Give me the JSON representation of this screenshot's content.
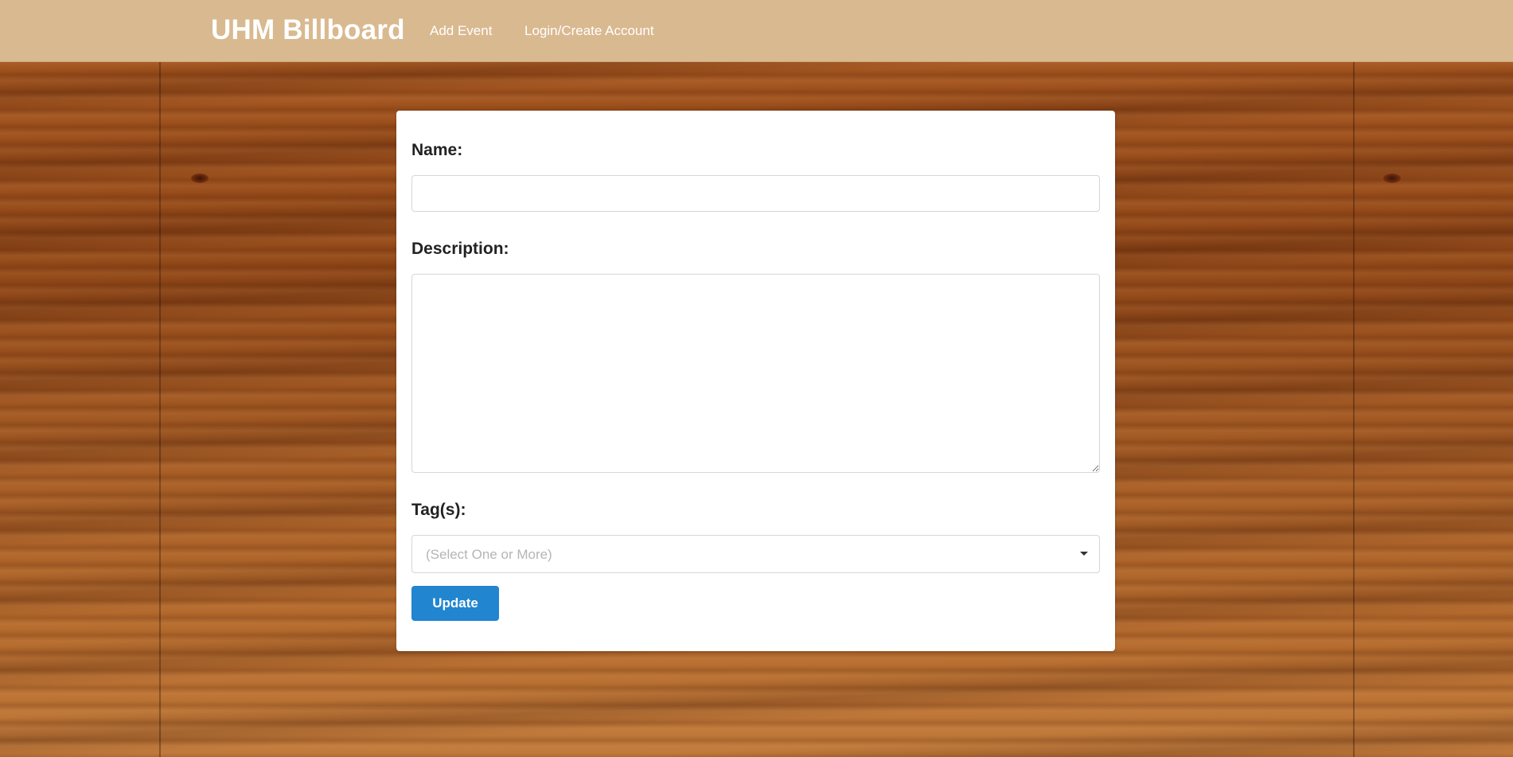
{
  "navbar": {
    "brand": "UHM Billboard",
    "links": [
      {
        "label": "Add Event"
      },
      {
        "label": "Login/Create Account"
      }
    ]
  },
  "form": {
    "name_label": "Name:",
    "name_value": "",
    "description_label": "Description:",
    "description_value": "",
    "tags_label": "Tag(s):",
    "tags_placeholder": "(Select One or More)",
    "submit_label": "Update"
  },
  "colors": {
    "navbar_bg": "#d9b990",
    "button_primary": "#2185d0",
    "card_bg": "#ffffff"
  }
}
